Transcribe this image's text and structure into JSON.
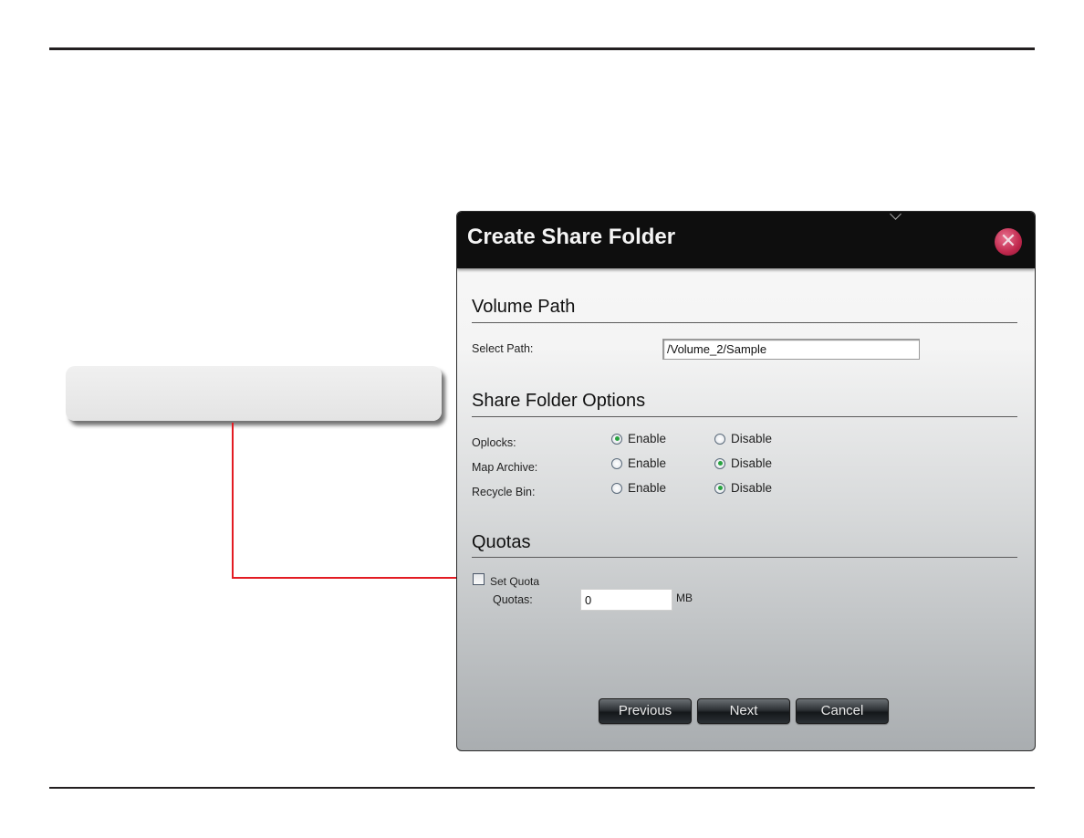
{
  "dialog": {
    "title": "Create Share Folder",
    "close_icon": "close-icon"
  },
  "volume_path": {
    "heading": "Volume Path",
    "select_path_label": "Select Path:",
    "select_path_value": "/Volume_2/Sample"
  },
  "share_options": {
    "heading": "Share Folder Options",
    "rows": [
      {
        "label": "Oplocks:",
        "enable_label": "Enable",
        "disable_label": "Disable",
        "selected": "Enable"
      },
      {
        "label": "Map Archive:",
        "enable_label": "Enable",
        "disable_label": "Disable",
        "selected": "Disable"
      },
      {
        "label": "Recycle Bin:",
        "enable_label": "Enable",
        "disable_label": "Disable",
        "selected": "Disable"
      }
    ]
  },
  "quotas": {
    "heading": "Quotas",
    "set_quota_label": "Set Quota",
    "set_quota_checked": false,
    "quotas_label": "Quotas:",
    "quotas_value": "0",
    "unit": "MB"
  },
  "buttons": {
    "previous": "Previous",
    "next": "Next",
    "cancel": "Cancel"
  },
  "colors": {
    "callout_line": "#e31b23",
    "header_bg": "#0e0e0e",
    "radio_selected": "#29a340"
  }
}
